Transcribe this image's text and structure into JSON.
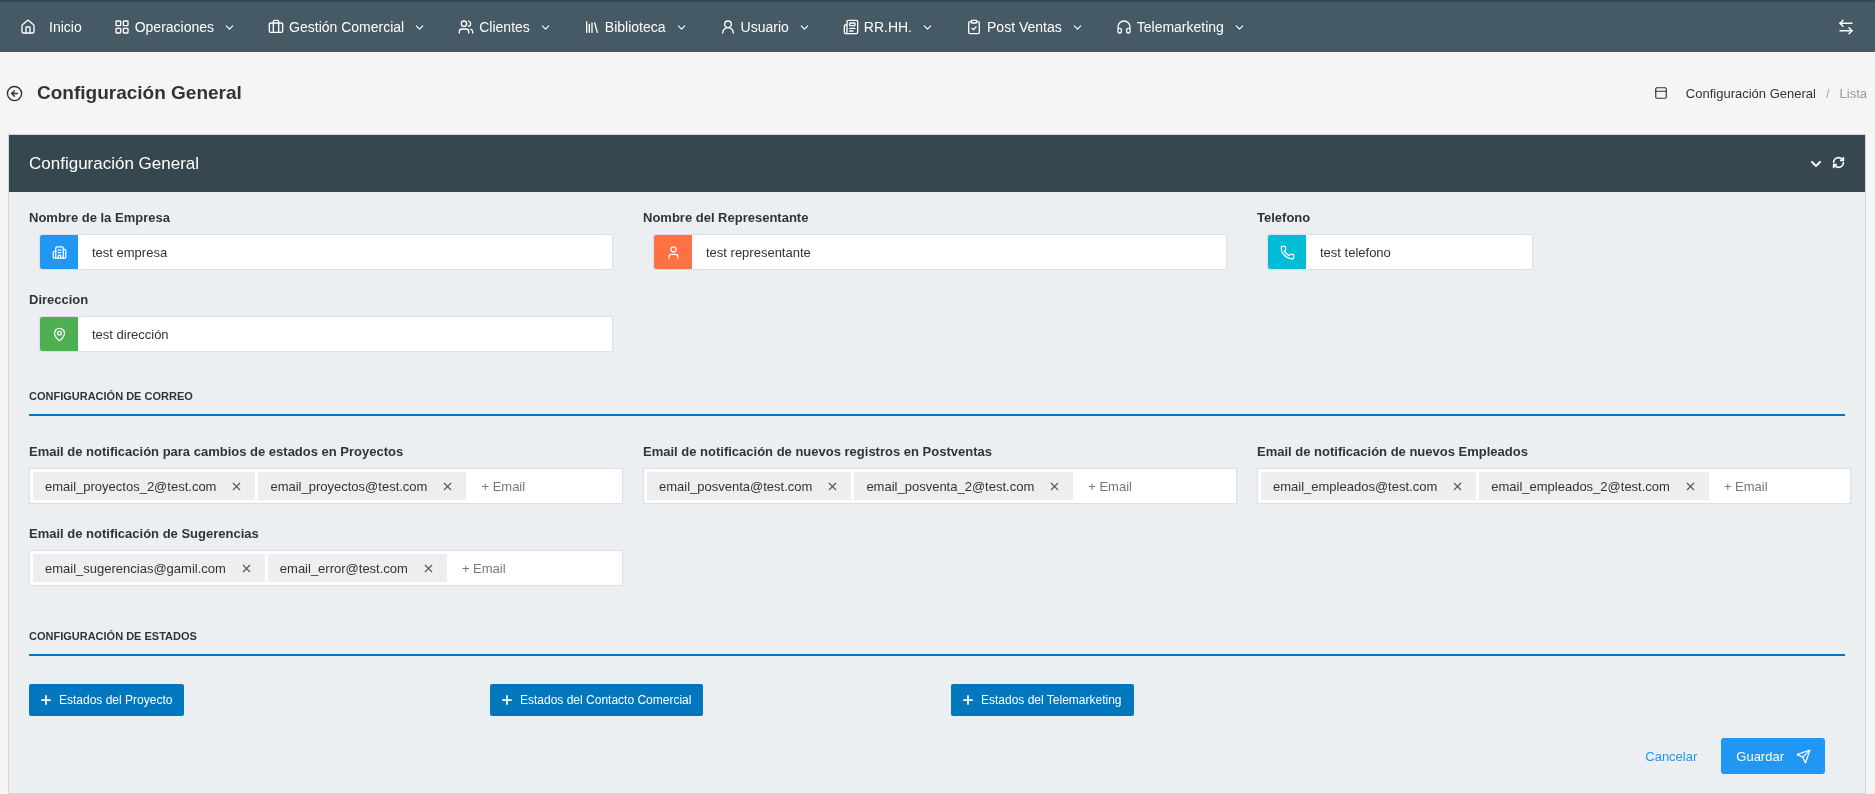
{
  "nav": {
    "items": [
      {
        "label": "Inicio",
        "dropdown": false
      },
      {
        "label": "Operaciones",
        "dropdown": true
      },
      {
        "label": "Gestión Comercial",
        "dropdown": true
      },
      {
        "label": "Clientes",
        "dropdown": true
      },
      {
        "label": "Biblioteca",
        "dropdown": true
      },
      {
        "label": "Usuario",
        "dropdown": true
      },
      {
        "label": "RR.HH.",
        "dropdown": true
      },
      {
        "label": "Post Ventas",
        "dropdown": true
      },
      {
        "label": "Telemarketing",
        "dropdown": true
      }
    ]
  },
  "page_title": "Configuración General",
  "breadcrumb": {
    "items": [
      "Configuración General",
      "Lista"
    ],
    "separator": "/"
  },
  "card": {
    "title": "Configuración General",
    "fields": [
      {
        "label": "Nombre de la Empresa",
        "value": "test empresa",
        "color": "#2196f3",
        "kind": "building"
      },
      {
        "label": "Nombre del Representante",
        "value": "test representante",
        "color": "#ff7043",
        "kind": "user"
      },
      {
        "label": "Telefono",
        "value": "test telefono",
        "color": "#00bcd4",
        "kind": "phone"
      },
      {
        "label": "Direccion",
        "value": "test dirección",
        "color": "#4caf50",
        "kind": "pin"
      }
    ],
    "mail_section": "CONFIGURACIÓN DE CORREO",
    "email_fields": [
      {
        "label": "Email de notificación para cambios de estados en Proyectos",
        "tags": [
          "email_proyectos_2@test.com",
          "email_proyectos@test.com"
        ],
        "placeholder": "+ Email"
      },
      {
        "label": "Email de notificación de nuevos registros en Postventas",
        "tags": [
          "email_posventa@test.com",
          "email_posventa_2@test.com"
        ],
        "placeholder": "+ Email"
      },
      {
        "label": "Email de notificación de nuevos Empleados",
        "tags": [
          "email_empleados@test.com",
          "email_empleados_2@test.com"
        ],
        "placeholder": "+ Email"
      },
      {
        "label": "Email de notificación de Sugerencias",
        "tags": [
          "email_sugerencias@gamil.com",
          "email_error@test.com"
        ],
        "placeholder": "+ Email"
      }
    ],
    "states_section": "CONFIGURACIÓN DE ESTADOS",
    "state_buttons": [
      "Estados del Proyecto",
      "Estados del Contacto Comercial",
      "Estados del Telemarketing"
    ],
    "cancel": "Cancelar",
    "save": "Guardar"
  }
}
